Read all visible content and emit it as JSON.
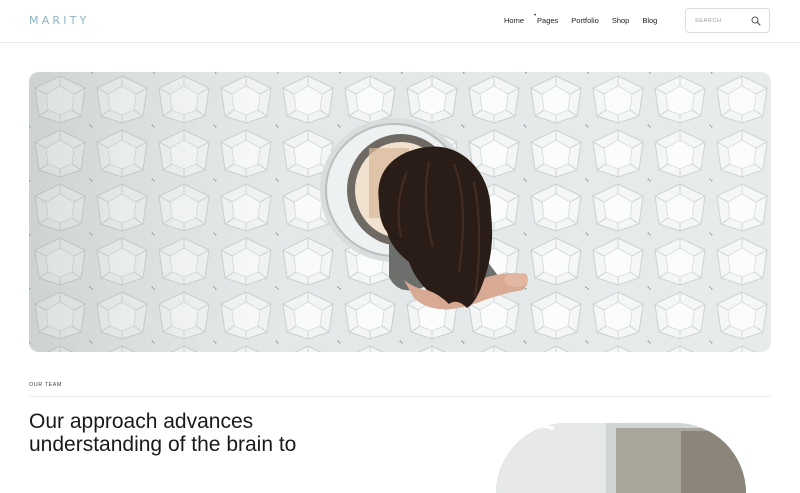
{
  "header": {
    "logo": "MARITY",
    "nav": [
      "Home",
      "Pages",
      "Portfolio",
      "Shop",
      "Blog"
    ],
    "search_placeholder": "SEARCH",
    "search_icon": "search-icon"
  },
  "hero": {
    "image": "woman-looking-through-round-window-in-geometric-wall"
  },
  "team": {
    "label": "OUR TEAM",
    "headline": "Our approach advances understanding of the brain to"
  },
  "colors": {
    "logo": "#8fb4c9",
    "text": "#1a1a1a",
    "divider": "#ececec"
  }
}
